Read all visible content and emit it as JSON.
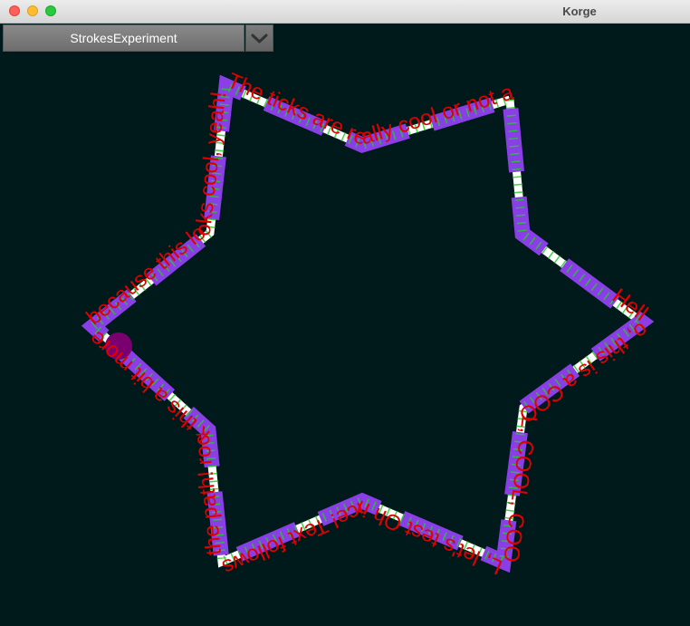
{
  "window": {
    "title": "Korge"
  },
  "toolbar": {
    "scene_name": "StrokesExperiment",
    "dropdown_icon": "chevron-down-icon"
  },
  "canvas": {
    "background": "#001a1c",
    "stroke_color": "#8a3ee6",
    "dash_color": "#ffffff",
    "tick_color": "#22cc22",
    "text_color": "#e00000",
    "marker_color": "#7a0070",
    "path_text": "Hello, this is a COOL, COOL, COOL, let's test Oh nice! Text follows the path! rock this a bit more because this looks cool, yeah! The ticks are really cool or not at all"
  }
}
